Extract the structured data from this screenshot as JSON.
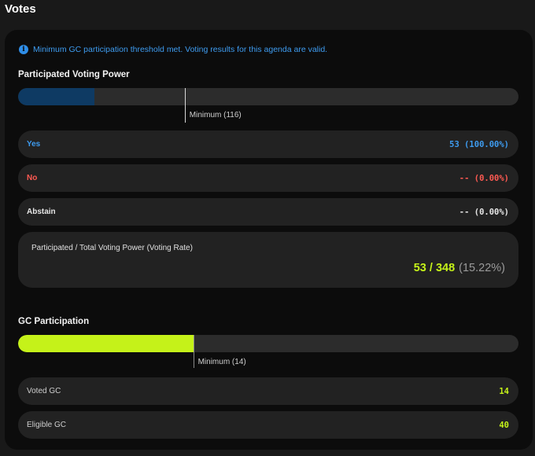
{
  "page_title": "Votes",
  "notice": {
    "icon": "info-icon",
    "text": "Minimum GC participation threshold met. Voting results for this agenda are valid."
  },
  "voting_power": {
    "title": "Participated Voting Power",
    "fill_fraction": 0.1523,
    "threshold_fraction": 0.333,
    "fill_color": "#0e3a63",
    "minimum_label": "Minimum (116)"
  },
  "votes": [
    {
      "label": "Yes",
      "value": "53 (100.00%)"
    },
    {
      "label": "No",
      "value": "-- (0.00%)"
    },
    {
      "label": "Abstain",
      "value": "-- (0.00%)"
    }
  ],
  "voting_rate": {
    "label": "Participated / Total Voting Power (Voting Rate)",
    "value": "53 / 348",
    "percent": "(15.22%)"
  },
  "gc": {
    "title": "GC Participation",
    "fill_fraction": 0.35,
    "threshold_fraction": 0.35,
    "fill_color": "#c5f219",
    "minimum_label": "Minimum (14)",
    "rows": [
      {
        "label": "Voted GC",
        "value": "14"
      },
      {
        "label": "Eligible GC",
        "value": "40"
      }
    ]
  },
  "colors": {
    "yes": "#3e9cf0",
    "no": "#ff5a52",
    "accent": "#c5f219",
    "info": "#3e9cf0"
  }
}
